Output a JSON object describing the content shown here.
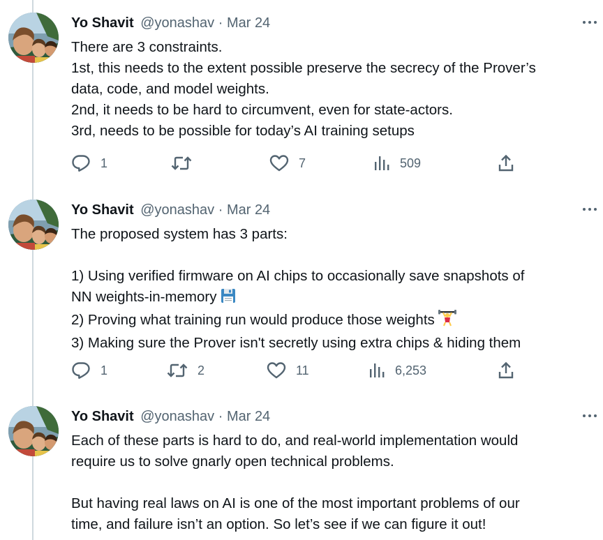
{
  "tweets": [
    {
      "author_name": "Yo Shavit",
      "handle": "@yonashav",
      "separator": "·",
      "date": "Mar 24",
      "lines": [
        "There are 3 constraints.",
        "1st, this needs to the extent possible preserve the secrecy of the Prover’s",
        "data, code, and model weights.",
        "2nd, it needs to be hard to circumvent, even for state-actors.",
        "3rd, needs to be possible for today’s AI training setups"
      ],
      "replies": "1",
      "retweets": "",
      "likes": "7",
      "views": "509"
    },
    {
      "author_name": "Yo Shavit",
      "handle": "@yonashav",
      "separator": "·",
      "date": "Mar 24",
      "lines": [
        "The proposed system has 3 parts:",
        "",
        "1) Using verified firmware on AI chips to occasionally save snapshots of",
        "NN weights-in-memory",
        "2) Proving what training run would produce those weights",
        "3) Making sure the Prover isn't secretly using extra chips & hiding them"
      ],
      "emoji": [
        "floppy-disk-emoji",
        "weightlifter-emoji"
      ],
      "replies": "1",
      "retweets": "2",
      "likes": "11",
      "views": "6,253"
    },
    {
      "author_name": "Yo Shavit",
      "handle": "@yonashav",
      "separator": "·",
      "date": "Mar 24",
      "lines": [
        "Each of these parts is hard to do, and real-world implementation would",
        "require us to solve gnarly open technical problems.",
        "",
        "But having real laws on AI is one of the most important problems of our",
        "time, and failure isn’t an option. So let’s see if we can figure it out!"
      ]
    }
  ],
  "icons": {
    "reply": "reply-icon",
    "retweet": "retweet-icon",
    "like": "heart-icon",
    "views": "views-icon",
    "share": "share-icon",
    "more": "more-options-icon"
  },
  "colors": {
    "text": "#0f1419",
    "secondary": "#536471",
    "thread_line": "#cfd9de",
    "background": "#ffffff"
  }
}
